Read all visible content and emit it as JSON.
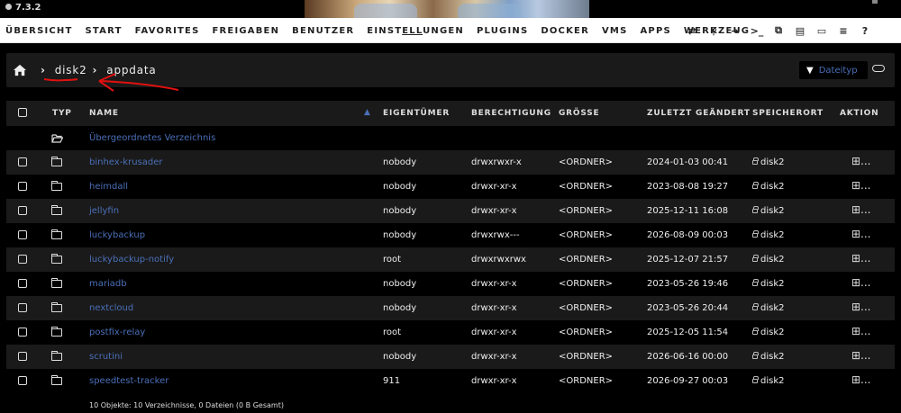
{
  "app": {
    "version": "7.3.2"
  },
  "nav": {
    "items": [
      {
        "id": "uebersicht",
        "label": "ÜBERSICHT"
      },
      {
        "id": "start",
        "label": "START"
      },
      {
        "id": "favorites",
        "label": "FAVORITES"
      },
      {
        "id": "freigaben",
        "label": "FREIGABEN"
      },
      {
        "id": "benutzer",
        "label": "BENUTZER"
      },
      {
        "id": "einstellungen",
        "label": "EINSTELLUNGEN"
      },
      {
        "id": "plugins",
        "label": "PLUGINS"
      },
      {
        "id": "docker",
        "label": "DOCKER"
      },
      {
        "id": "vms",
        "label": "VMS"
      },
      {
        "id": "apps",
        "label": "APPS"
      },
      {
        "id": "werkzeug",
        "label": "WERKZEUG"
      }
    ],
    "active": "einstellungen",
    "icons": [
      "sync-icon",
      "search-icon",
      "logout-icon",
      "terminal-icon",
      "copy-icon",
      "feedback-icon",
      "monitor-icon",
      "log-icon",
      "help-icon"
    ]
  },
  "breadcrumb": {
    "items": [
      "disk2",
      "appdata"
    ],
    "filter_label": "Dateityp"
  },
  "table": {
    "headers": {
      "typ": "TYP",
      "name": "NAME",
      "owner": "EIGENTÜMER",
      "perm": "BERECHTIGUNG",
      "size": "GRÖSSE",
      "modified": "ZULETZT GEÄNDERT",
      "location": "SPEICHERORT",
      "action": "AKTION"
    },
    "parent_label": "Übergeordnetes Verzeichnis",
    "rows": [
      {
        "name": "binhex-krusader",
        "owner": "nobody",
        "perm": "drwxrwxr-x",
        "size": "<ORDNER>",
        "modified": "2024-01-03 00:41",
        "location": "disk2",
        "action": "⊞..."
      },
      {
        "name": "heimdall",
        "owner": "nobody",
        "perm": "drwxr-xr-x",
        "size": "<ORDNER>",
        "modified": "2023-08-08 19:27",
        "location": "disk2",
        "action": "⊞..."
      },
      {
        "name": "jellyfin",
        "owner": "nobody",
        "perm": "drwxr-xr-x",
        "size": "<ORDNER>",
        "modified": "2025-12-11 16:08",
        "location": "disk2",
        "action": "⊞..."
      },
      {
        "name": "luckybackup",
        "owner": "nobody",
        "perm": "drwxrwx---",
        "size": "<ORDNER>",
        "modified": "2026-08-09 00:03",
        "location": "disk2",
        "action": "⊞..."
      },
      {
        "name": "luckybackup-notify",
        "owner": "root",
        "perm": "drwxrwxrwx",
        "size": "<ORDNER>",
        "modified": "2025-12-07 21:57",
        "location": "disk2",
        "action": "⊞..."
      },
      {
        "name": "mariadb",
        "owner": "nobody",
        "perm": "drwxr-xr-x",
        "size": "<ORDNER>",
        "modified": "2023-05-26 19:46",
        "location": "disk2",
        "action": "⊞..."
      },
      {
        "name": "nextcloud",
        "owner": "nobody",
        "perm": "drwxr-xr-x",
        "size": "<ORDNER>",
        "modified": "2023-05-26 20:44",
        "location": "disk2",
        "action": "⊞..."
      },
      {
        "name": "postfix-relay",
        "owner": "root",
        "perm": "drwxr-xr-x",
        "size": "<ORDNER>",
        "modified": "2025-12-05 11:54",
        "location": "disk2",
        "action": "⊞..."
      },
      {
        "name": "scrutini",
        "owner": "nobody",
        "perm": "drwxr-xr-x",
        "size": "<ORDNER>",
        "modified": "2026-06-16 00:00",
        "location": "disk2",
        "action": "⊞..."
      },
      {
        "name": "speedtest-tracker",
        "owner": "911",
        "perm": "drwxr-xr-x",
        "size": "<ORDNER>",
        "modified": "2026-09-27 00:03",
        "location": "disk2",
        "action": "⊞..."
      }
    ],
    "footer": "10 Objekte: 10 Verzeichnisse, 0 Dateien (0 B Gesamt)"
  },
  "colors": {
    "link": "#4a6fb8",
    "annotation": "#e01010",
    "panel": "#1a1a1a"
  }
}
